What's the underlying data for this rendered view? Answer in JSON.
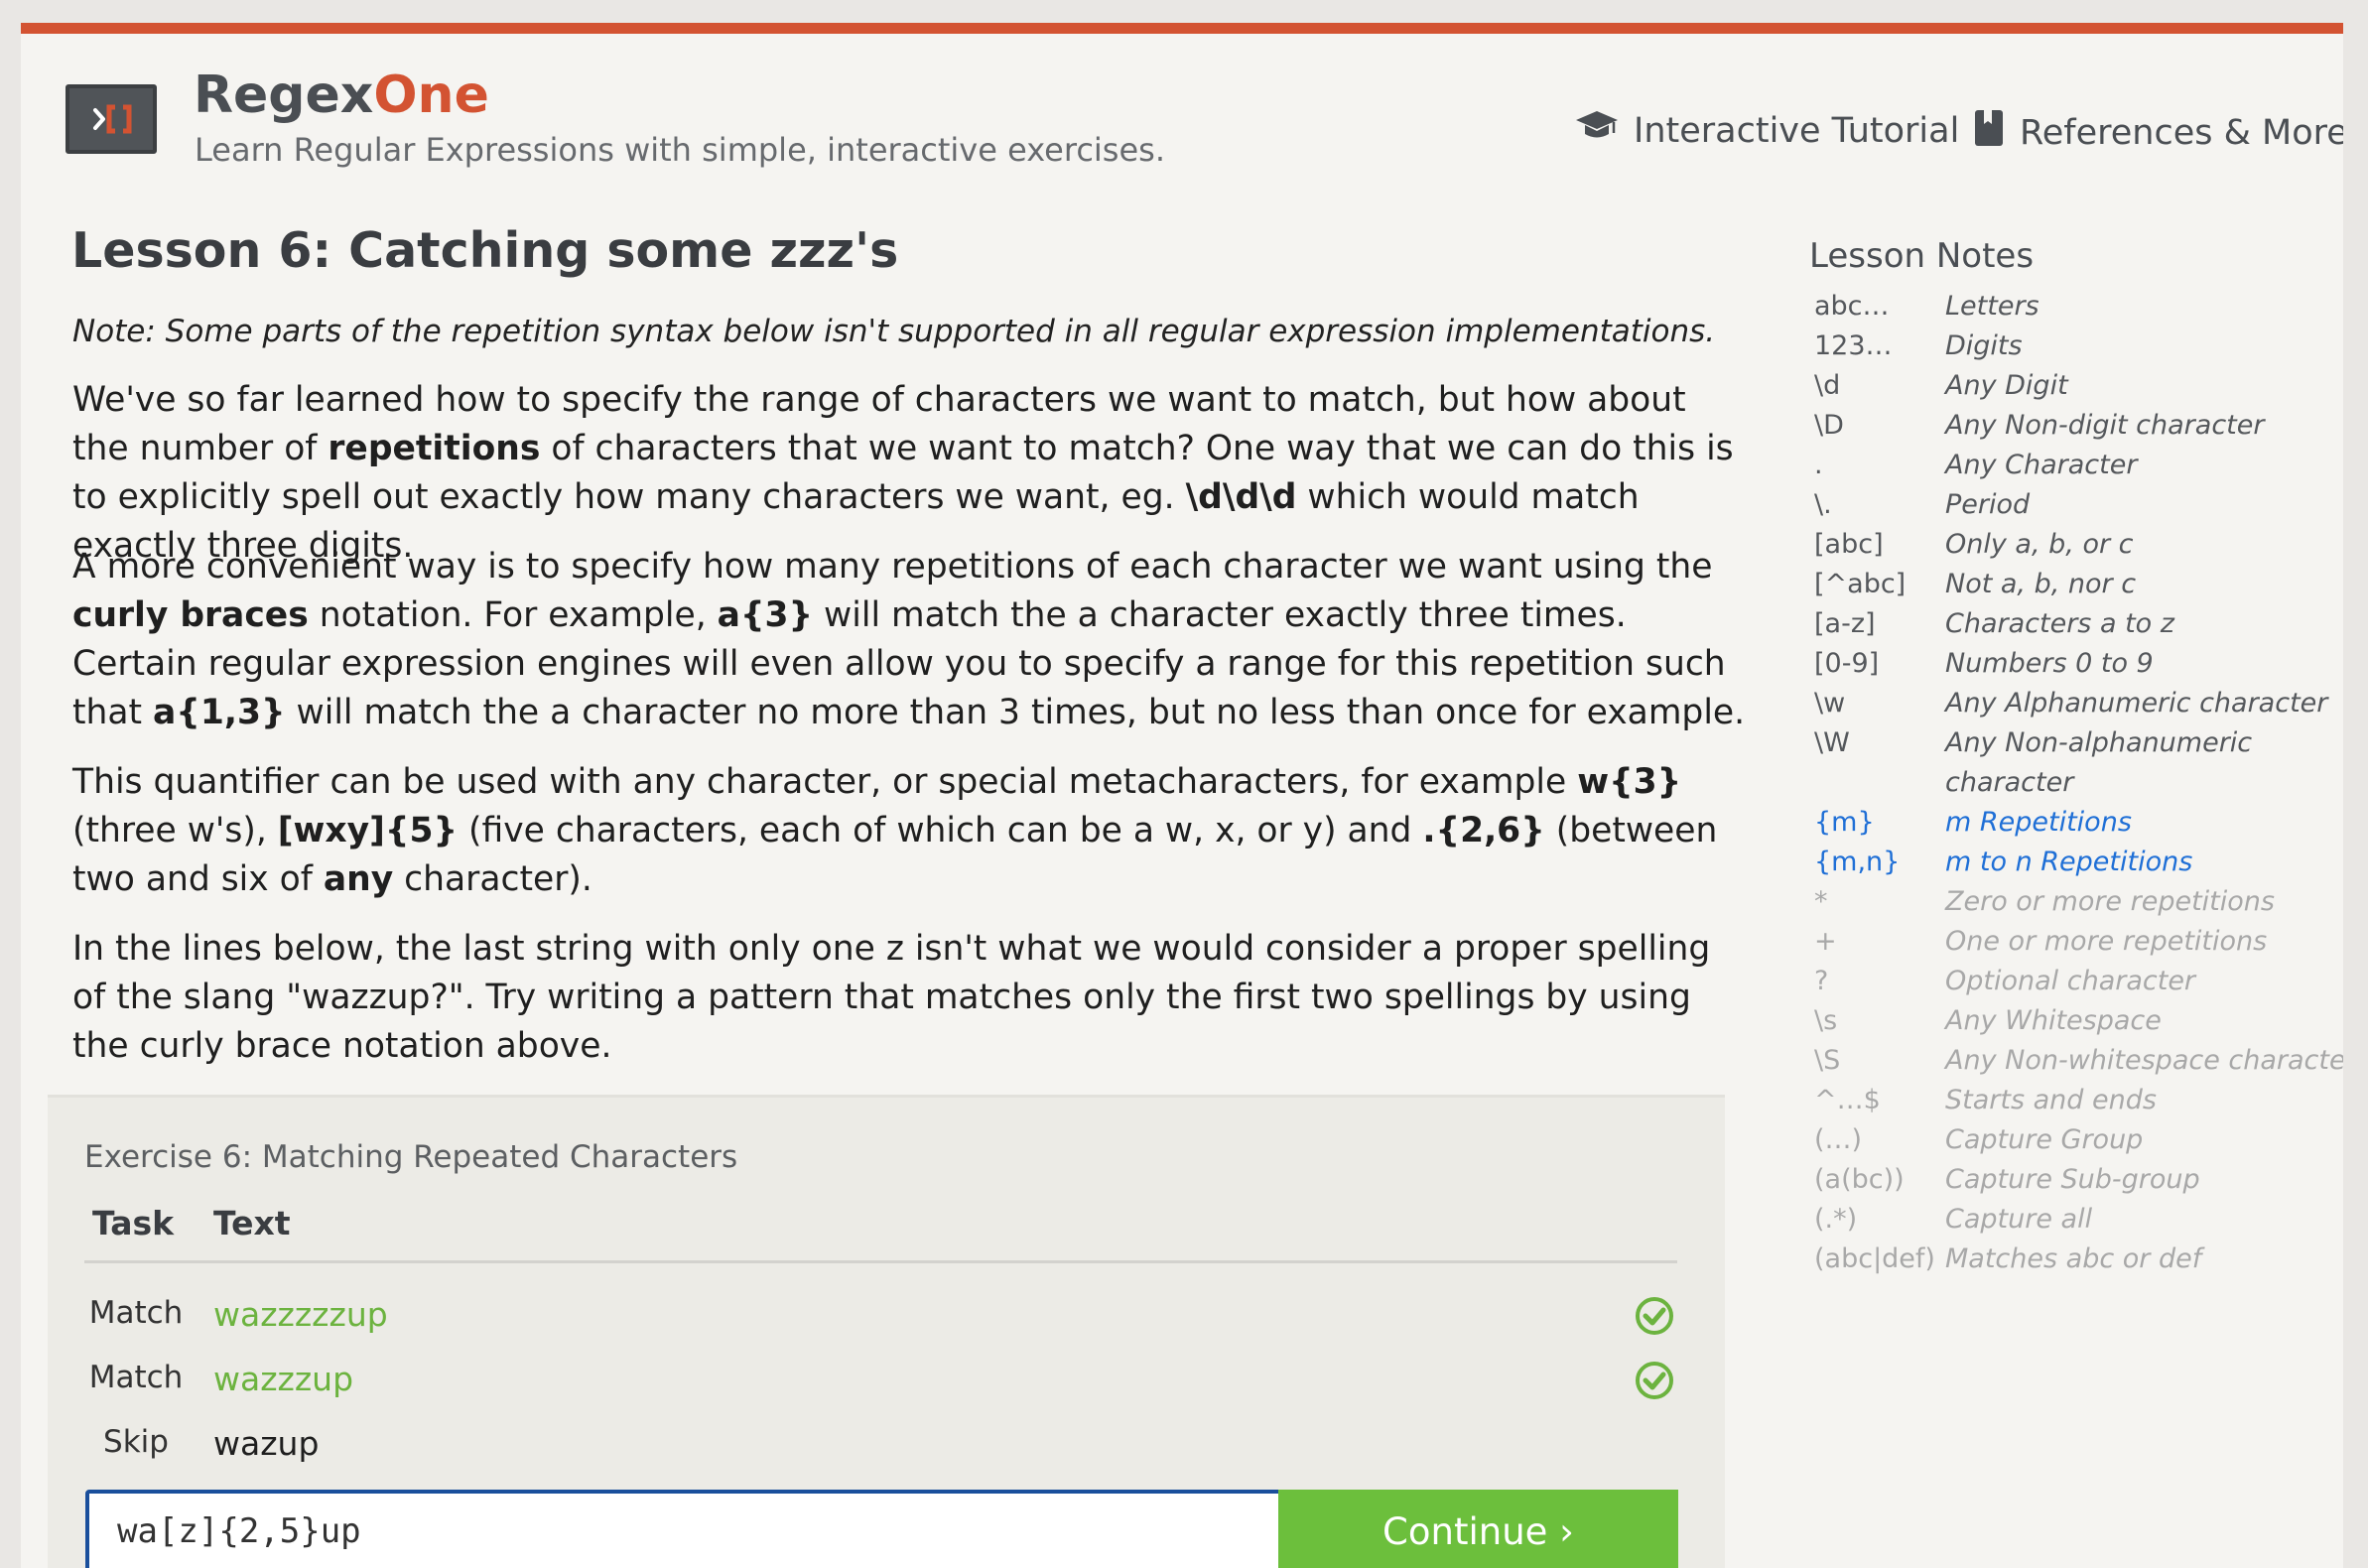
{
  "header": {
    "brand_regex": "Regex",
    "brand_one": "One",
    "tagline": "Learn Regular Expressions with simple, interactive exercises.",
    "nav": [
      {
        "label": "Interactive Tutorial",
        "icon": "graduation-cap-icon"
      },
      {
        "label": "References & More",
        "icon": "bookmark-icon"
      }
    ]
  },
  "lesson": {
    "title": "Lesson 6: Catching some zzz's",
    "note": "Note: Some parts of the repetition syntax below isn't supported in all regular expression implementations.",
    "p1": {
      "a": "We've so far learned how to specify the range of characters we want to match, but how about the number of ",
      "b": "repetitions",
      "c": " of characters that we want to match? One way that we can do this is to explicitly spell out exactly how many characters we want, eg. ",
      "d": "\\d\\d\\d",
      "e": " which would match exactly three digits."
    },
    "p2": {
      "a": "A more convenient way is to specify how many repetitions of each character we want using the ",
      "b": "curly braces",
      "c": " notation. For example, ",
      "d": "a{3}",
      "e": " will match the a character exactly three times. Certain regular expression engines will even allow you to specify a range for this repetition such that ",
      "f": "a{1,3}",
      "g": " will match the a character no more than 3 times, but no less than once for example."
    },
    "p3": {
      "a": "This quantifier can be used with any character, or special metacharacters, for example ",
      "b": "w{3}",
      "c": " (three w's), ",
      "d": "[wxy]{5}",
      "e": " (five characters, each of which can be a w, x, or y) and ",
      "f": ".{2,6}",
      "g": " (between two and six of ",
      "h": "any",
      "i": " character)."
    },
    "p4": "In the lines below, the last string with only one z isn't what we would consider a proper spelling of the slang \"wazzup?\". Try writing a pattern that matches only the first two spellings by using the curly brace notation above."
  },
  "exercise": {
    "title": "Exercise 6: Matching Repeated Characters",
    "head_task": "Task",
    "head_text": "Text",
    "rows": [
      {
        "task": "Match",
        "text": "wazzzzzup",
        "status": "check-icon"
      },
      {
        "task": "Match",
        "text": "wazzzup",
        "status": "check-icon"
      },
      {
        "task": "Skip",
        "text": "wazup",
        "status": ""
      }
    ],
    "input_value": "wa[z]{2,5}up",
    "continue_label": "Continue ›"
  },
  "notes": {
    "title": "Lesson Notes",
    "items": [
      {
        "k": "abc…",
        "v": "Letters"
      },
      {
        "k": "123…",
        "v": "Digits"
      },
      {
        "k": "\\d",
        "v": "Any Digit"
      },
      {
        "k": "\\D",
        "v": "Any Non-digit character"
      },
      {
        "k": ".",
        "v": "Any Character"
      },
      {
        "k": "\\.",
        "v": "Period"
      },
      {
        "k": "[abc]",
        "v": "Only a, b, or c"
      },
      {
        "k": "[^abc]",
        "v": "Not a, b, nor c"
      },
      {
        "k": "[a-z]",
        "v": "Characters a to z"
      },
      {
        "k": "[0-9]",
        "v": "Numbers 0 to 9"
      },
      {
        "k": "\\w",
        "v": "Any Alphanumeric character"
      },
      {
        "k": "\\W",
        "v": "Any Non-alphanumeric",
        "v2": "character"
      },
      {
        "k": "{m}",
        "v": "m Repetitions"
      },
      {
        "k": "{m,n}",
        "v": "m to n Repetitions"
      },
      {
        "k": "*",
        "v": "Zero or more repetitions"
      },
      {
        "k": "+",
        "v": "One or more repetitions"
      },
      {
        "k": "?",
        "v": "Optional character"
      },
      {
        "k": "\\s",
        "v": "Any Whitespace"
      },
      {
        "k": "\\S",
        "v": "Any Non-whitespace character"
      },
      {
        "k": "^…$",
        "v": "Starts and ends"
      },
      {
        "k": "(…)",
        "v": "Capture Group"
      },
      {
        "k": "(a(bc))",
        "v": "Capture Sub-group"
      },
      {
        "k": "(.*)",
        "v": "Capture all"
      },
      {
        "k": "(abc|def)",
        "v": "Matches abc or def"
      }
    ]
  },
  "colors": {
    "accent": "#d35332",
    "success": "#6cb33f",
    "button": "#6cbf3c",
    "active_note": "#1f6fd6",
    "input_border": "#1a4f9c"
  }
}
